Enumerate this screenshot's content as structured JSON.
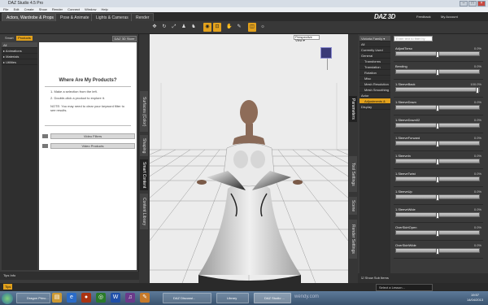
{
  "window": {
    "title": "DAZ Studio 4.5 Pro",
    "controls": [
      "–",
      "□",
      "×"
    ]
  },
  "menu": [
    "File",
    "Edit",
    "Create",
    "Show",
    "Render",
    "Connect",
    "Window",
    "Help"
  ],
  "main_tabs": [
    "Actors, Wardrobe & Props",
    "Pose & Animate",
    "Lights & Cameras",
    "Render"
  ],
  "header": {
    "logo": "DAZ 3D",
    "links": [
      "Feedback",
      "My Account"
    ]
  },
  "toolbar_icons": [
    "move-icon",
    "rotate-icon",
    "scale-icon",
    "pose-icon",
    "figure-icon",
    "node-icon",
    "view-icon",
    "render-icon",
    "camera-icon",
    "light-icon",
    "spot-icon",
    "settings-icon"
  ],
  "left_panel": {
    "tabs": [
      "Smart",
      "Products"
    ],
    "store_button": "DAZ 3D Store",
    "categories": [
      "All",
      "Animations",
      "Materials",
      "Utilities"
    ],
    "content": {
      "heading": "Where Are My Products?",
      "steps": [
        "1. Make a selection from the left.",
        "2. Double-click a product to explore it."
      ],
      "note": "NOTE: You may need to clear your keyword filter to see results.",
      "buttons": [
        "Video Filters",
        "Video Products"
      ]
    },
    "footer": "Tips   Info"
  },
  "left_vtabs": [
    "Surfaces (Color)",
    "Shaping",
    "Smart Content",
    "Content Library"
  ],
  "viewport": {
    "camera": "Perspective View"
  },
  "right_vtabs": [
    "Parameters",
    "Tool Settings",
    "Scene",
    "Render Settings"
  ],
  "right_panel": {
    "node": "Victoria Family",
    "filter_placeholder": "Enter text to filter by",
    "tree": [
      "All",
      "Currently Used",
      "General",
      "Transforms",
      "Translation",
      "Rotation",
      "Misc",
      "Mesh Resolution",
      "Mesh Smoothing",
      "Actor",
      "Adjustments & Mo...",
      "Display"
    ],
    "selected": "Adjustments & Mo...",
    "sliders": [
      {
        "name": "AdjustTorso",
        "value": "0.0%",
        "pos": 0.5
      },
      {
        "name": "Bending",
        "value": "0.0%",
        "pos": 0.5
      },
      {
        "name": "1.SleeveBack",
        "value": "100.0%",
        "pos": 0.98
      },
      {
        "name": "1.SleeveDown",
        "value": "0.0%",
        "pos": 0.5
      },
      {
        "name": "1.SleeveDown02",
        "value": "0.0%",
        "pos": 0.5
      },
      {
        "name": "1.SleeveForward",
        "value": "0.0%",
        "pos": 0.5
      },
      {
        "name": "1.SleeveIn",
        "value": "0.0%",
        "pos": 0.5
      },
      {
        "name": "1.SleeveTwist",
        "value": "0.0%",
        "pos": 0.5
      },
      {
        "name": "1.SleeveUp",
        "value": "0.0%",
        "pos": 0.5
      },
      {
        "name": "1.SleeveWide",
        "value": "0.0%",
        "pos": 0.5
      },
      {
        "name": "OverSkirtOpen",
        "value": "0.0%",
        "pos": 0.5
      },
      {
        "name": "OverSkirtWide",
        "value": "0.0%",
        "pos": 0.5
      }
    ],
    "show_sub_items": "Show Sub Items"
  },
  "statusbar": {
    "left": "Tips",
    "right": "Select a Lesson..."
  },
  "taskbar": {
    "items": [
      "Dragon Princ...",
      "DAZ Discussi...",
      "Library",
      "DAZ Studio ..."
    ],
    "time": "19:57",
    "date": "14/04/2013",
    "watermark": "wendy.com"
  },
  "colors": {
    "accent": "#e2a11c",
    "panel": "#3b3b3b",
    "viewport": "#ececec"
  }
}
